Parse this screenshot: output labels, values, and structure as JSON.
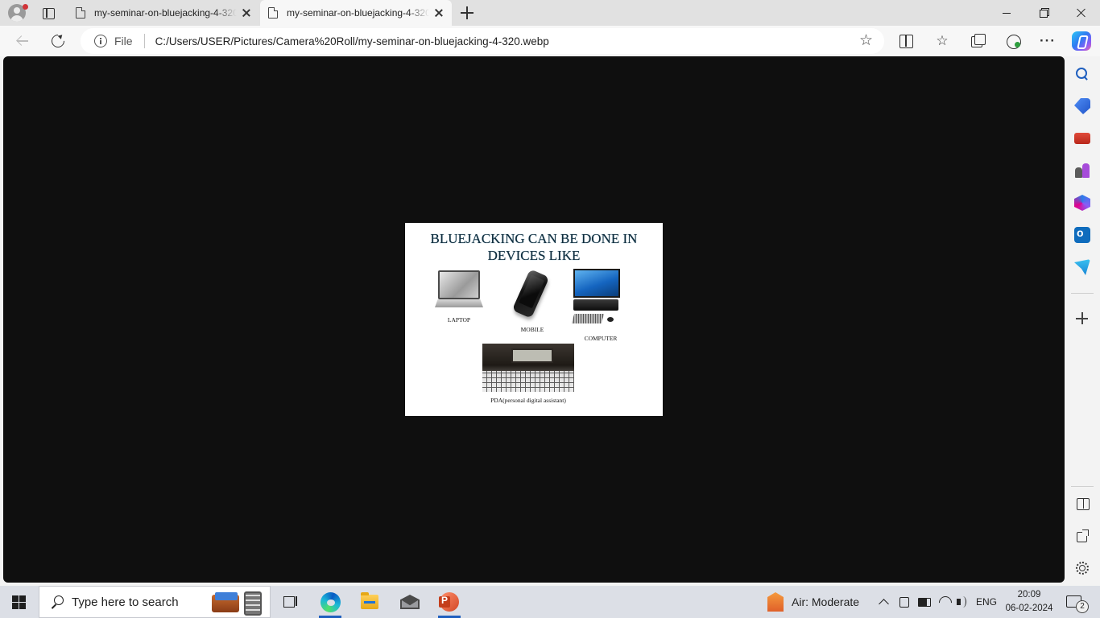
{
  "browser": {
    "tabs": [
      {
        "title": "my-seminar-on-bluejacking-4-320.webp",
        "active": false
      },
      {
        "title": "my-seminar-on-bluejacking-4-320.webp",
        "active": true
      }
    ],
    "address": {
      "scheme_label": "File",
      "url": "C:/Users/USER/Pictures/Camera%20Roll/my-seminar-on-bluejacking-4-320.webp"
    },
    "toolbar_icons": [
      "back-icon",
      "refresh-icon",
      "info-icon",
      "star-icon",
      "split-screen-icon",
      "favorites-icon",
      "collections-icon",
      "performance-icon",
      "more-icon",
      "copilot-icon"
    ],
    "sidebar_icons": [
      "search-icon",
      "shopping-tag-icon",
      "tools-icon",
      "games-icon",
      "microsoft-365-icon",
      "outlook-icon",
      "drop-icon",
      "add-icon",
      "hide-sidebar-icon",
      "popout-icon",
      "settings-icon"
    ]
  },
  "slide": {
    "title_line1": "BLUEJACKING CAN BE DONE IN",
    "title_line2": "DEVICES LIKE",
    "devices": [
      {
        "label": "LAPTOP",
        "icon": "laptop-image"
      },
      {
        "label": "MOBILE",
        "icon": "mobile-phone-image"
      },
      {
        "label": "COMPUTER",
        "icon": "desktop-computer-image"
      },
      {
        "label": "PDA(personal digital assistant)",
        "icon": "pda-image"
      }
    ]
  },
  "taskbar": {
    "search_placeholder": "Type here to search",
    "apps": [
      "task-view",
      "microsoft-edge",
      "file-explorer",
      "mail",
      "powerpoint"
    ],
    "weather": "Air: Moderate",
    "language": "ENG",
    "time": "20:09",
    "date": "06-02-2024",
    "notification_count": "2"
  },
  "colors": {
    "viewer_background": "#0f0f0f",
    "tabstrip": "#e1e1e1",
    "taskbar": "#dcdfe6",
    "slide_title": "#0e2a3a"
  }
}
